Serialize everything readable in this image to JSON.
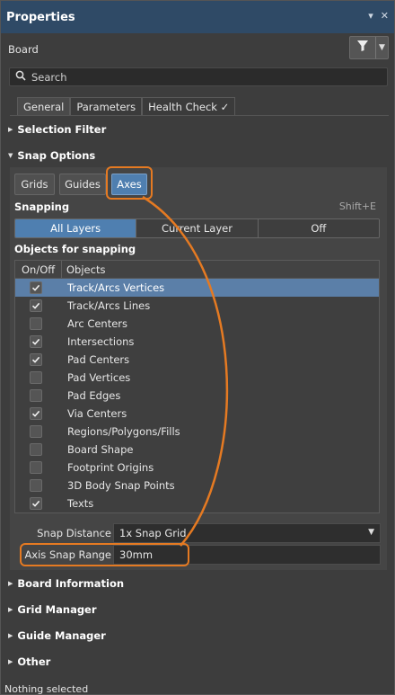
{
  "panel": {
    "title": "Properties",
    "board_label": "Board",
    "search_placeholder": "Search",
    "tabs": [
      {
        "label": "General"
      },
      {
        "label": "Parameters"
      },
      {
        "label": "Health Check ✓"
      }
    ],
    "icons": {
      "pin": "▾",
      "close": "✕",
      "filter": "filter-icon"
    }
  },
  "sections": {
    "selection_filter": "Selection Filter",
    "snap_options": "Snap Options",
    "board_information": "Board Information",
    "grid_manager": "Grid Manager",
    "guide_manager": "Guide Manager",
    "other": "Other"
  },
  "snap": {
    "buttons": [
      {
        "label": "Grids"
      },
      {
        "label": "Guides"
      },
      {
        "label": "Axes"
      }
    ],
    "active_button": "Axes",
    "snapping_label": "Snapping",
    "snapping_shortcut": "Shift+E",
    "layer_options": [
      {
        "label": "All Layers"
      },
      {
        "label": "Current Layer"
      },
      {
        "label": "Off"
      }
    ],
    "active_layer_option": "All Layers",
    "objects_label": "Objects for snapping",
    "table_headers": {
      "onoff": "On/Off",
      "objects": "Objects"
    },
    "objects": [
      {
        "name": "Track/Arcs Vertices",
        "checked": true,
        "selected": true
      },
      {
        "name": "Track/Arcs Lines",
        "checked": true,
        "selected": false
      },
      {
        "name": "Arc Centers",
        "checked": false,
        "selected": false
      },
      {
        "name": "Intersections",
        "checked": true,
        "selected": false
      },
      {
        "name": "Pad Centers",
        "checked": true,
        "selected": false
      },
      {
        "name": "Pad Vertices",
        "checked": false,
        "selected": false
      },
      {
        "name": "Pad Edges",
        "checked": false,
        "selected": false
      },
      {
        "name": "Via Centers",
        "checked": true,
        "selected": false
      },
      {
        "name": "Regions/Polygons/Fills",
        "checked": false,
        "selected": false
      },
      {
        "name": "Board Shape",
        "checked": false,
        "selected": false
      },
      {
        "name": "Footprint Origins",
        "checked": false,
        "selected": false
      },
      {
        "name": "3D Body Snap Points",
        "checked": false,
        "selected": false
      },
      {
        "name": "Texts",
        "checked": true,
        "selected": false
      }
    ],
    "snap_distance_label": "Snap Distance",
    "snap_distance_value": "1x Snap Grid",
    "axis_snap_range_label": "Axis Snap Range",
    "axis_snap_range_value": "30mm"
  },
  "status": "Nothing selected",
  "colors": {
    "accent": "#4f7fb0",
    "highlight": "#e57a22",
    "titlebar": "#2f4a66"
  }
}
